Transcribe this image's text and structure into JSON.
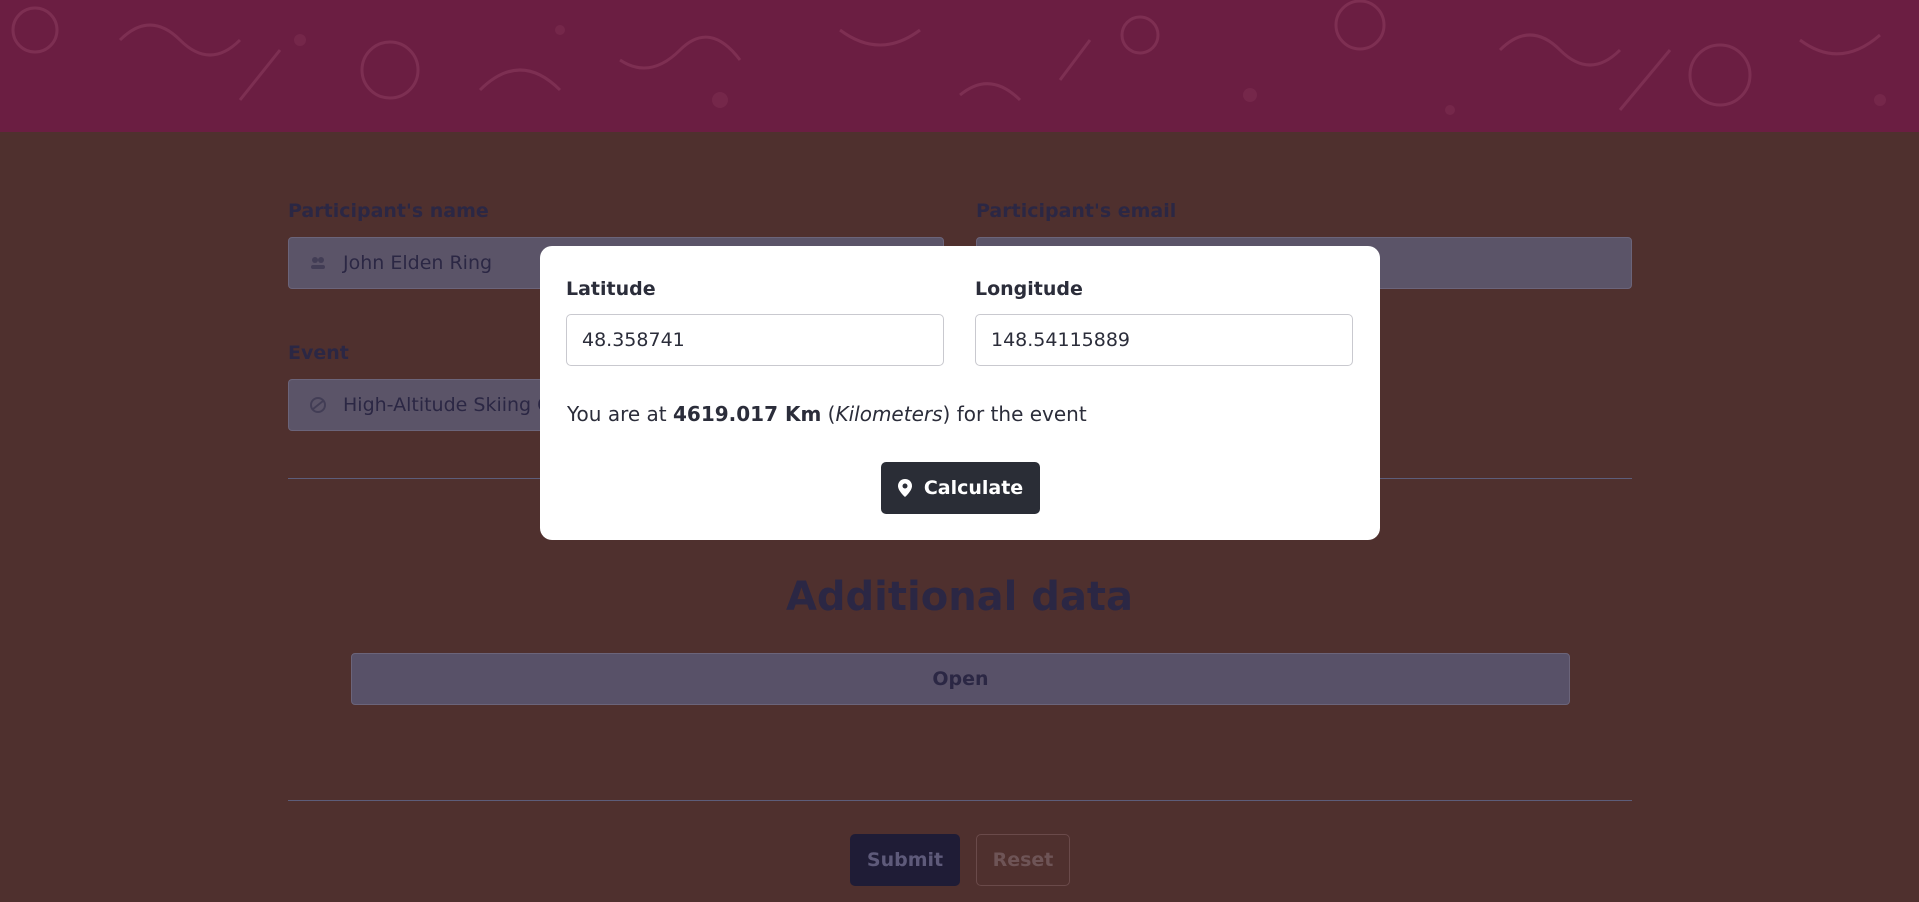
{
  "form": {
    "name_label": "Participant's name",
    "name_value": "John Elden Ring",
    "email_label": "Participant's email",
    "email_value": "",
    "event_label": "Event",
    "event_value": "High-Altitude Skiing C",
    "additional_title": "Additional data",
    "open_label": "Open",
    "submit_label": "Submit",
    "reset_label": "Reset"
  },
  "modal": {
    "latitude_label": "Latitude",
    "latitude_value": "48.358741",
    "longitude_label": "Longitude",
    "longitude_value": "148.54115889",
    "result_prefix": "You are at ",
    "result_distance": "4619.017 Km",
    "result_open_paren": " (",
    "result_unit": "Kilometers",
    "result_suffix": ") for the event",
    "calculate_label": "Calculate",
    "calculate_icon": "map-pin-icon"
  },
  "colors": {
    "page_bg": "#4f302e",
    "banner_bg": "#6b1e42",
    "modal_bg": "#ffffff",
    "calc_button_bg": "#2a2d36",
    "submit_button_bg": "#1f1c36"
  }
}
